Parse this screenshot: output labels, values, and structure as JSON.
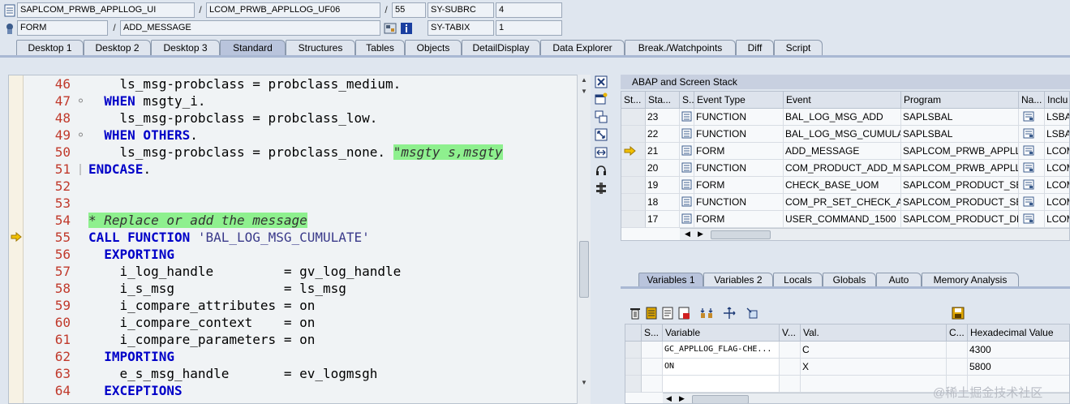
{
  "header": {
    "program": "SAPLCOM_PRWB_APPLLOG_UI",
    "include": "LCOM_PRWB_APPLLOG_UF06",
    "line": "55",
    "sy_subrc_label": "SY-SUBRC",
    "sy_subrc_value": "4",
    "event_type": "FORM",
    "event": "ADD_MESSAGE",
    "sy_tabix_label": "SY-TABIX",
    "sy_tabix_value": "1",
    "separator": "/"
  },
  "tabs": [
    "Desktop 1",
    "Desktop 2",
    "Desktop 3",
    "Standard",
    "Structures",
    "Tables",
    "Objects",
    "DetailDisplay",
    "Data Explorer",
    "Break./Watchpoints",
    "Diff",
    "Script"
  ],
  "active_tab": "Standard",
  "code": {
    "lines": [
      {
        "n": "46",
        "text": "    ls_msg-probclass = probclass_medium."
      },
      {
        "n": "47",
        "text": "  WHEN msgty_i."
      },
      {
        "n": "48",
        "text": "    ls_msg-probclass = probclass_low."
      },
      {
        "n": "49",
        "text": "  WHEN OTHERS."
      },
      {
        "n": "50",
        "text": "    ls_msg-probclass = probclass_none. ",
        "comment": "\"msgty s,msgty"
      },
      {
        "n": "51",
        "text": "ENDCASE."
      },
      {
        "n": "52",
        "text": ""
      },
      {
        "n": "53",
        "text": ""
      },
      {
        "n": "54",
        "text": "",
        "comment": "* Replace or add the message"
      },
      {
        "n": "55",
        "text": "CALL FUNCTION 'BAL_LOG_MSG_CUMULATE'"
      },
      {
        "n": "56",
        "text": "  EXPORTING"
      },
      {
        "n": "57",
        "text": "    i_log_handle         = gv_log_handle"
      },
      {
        "n": "58",
        "text": "    i_s_msg              = ls_msg"
      },
      {
        "n": "59",
        "text": "    i_compare_attributes = on"
      },
      {
        "n": "60",
        "text": "    i_compare_context    = on"
      },
      {
        "n": "61",
        "text": "    i_compare_parameters = on"
      },
      {
        "n": "62",
        "text": "  IMPORTING"
      },
      {
        "n": "63",
        "text": "    e_s_msg_handle       = ev_logmsgh"
      },
      {
        "n": "64",
        "text": "  EXCEPTIONS"
      }
    ]
  },
  "stack": {
    "title": "ABAP and Screen Stack",
    "columns": [
      "St...",
      "Sta...",
      "S...",
      "Event Type",
      "Event",
      "Program",
      "Na...",
      "Inclu"
    ],
    "rows": [
      {
        "level": "23",
        "type": "FUNCTION",
        "event": "BAL_LOG_MSG_ADD",
        "program": "SAPLSBAL",
        "include": "LSBA"
      },
      {
        "level": "22",
        "type": "FUNCTION",
        "event": "BAL_LOG_MSG_CUMULA...",
        "program": "SAPLSBAL",
        "include": "LSBA"
      },
      {
        "level": "21",
        "type": "FORM",
        "event": "ADD_MESSAGE",
        "program": "SAPLCOM_PRWB_APPLL...",
        "include": "LCOM"
      },
      {
        "level": "20",
        "type": "FUNCTION",
        "event": "COM_PRODUCT_ADD_M...",
        "program": "SAPLCOM_PRWB_APPLL...",
        "include": "LCOM"
      },
      {
        "level": "19",
        "type": "FORM",
        "event": "CHECK_BASE_UOM",
        "program": "SAPLCOM_PRODUCT_SET",
        "include": "LCOM"
      },
      {
        "level": "18",
        "type": "FUNCTION",
        "event": "COM_PR_SET_CHECK_A...",
        "program": "SAPLCOM_PRODUCT_SET",
        "include": "LCOM"
      },
      {
        "level": "17",
        "type": "FORM",
        "event": "USER_COMMAND_1500",
        "program": "SAPLCOM_PRODUCT_DE...",
        "include": "LCOM"
      }
    ]
  },
  "var_tabs": [
    "Variables 1",
    "Variables 2",
    "Locals",
    "Globals",
    "Auto",
    "Memory Analysis"
  ],
  "active_var_tab": "Variables 1",
  "variables": {
    "columns": [
      "S...",
      "Variable",
      "V...",
      "Val.",
      "C...",
      "Hexadecimal Value"
    ],
    "rows": [
      {
        "name": "GC_APPLLOG_FLAG-CHE...",
        "value": "C",
        "hex": "4300"
      },
      {
        "name": "ON",
        "value": "X",
        "hex": "5800"
      },
      {
        "name": "",
        "value": "",
        "hex": ""
      }
    ]
  },
  "watermark": "@稀土掘金技术社区"
}
